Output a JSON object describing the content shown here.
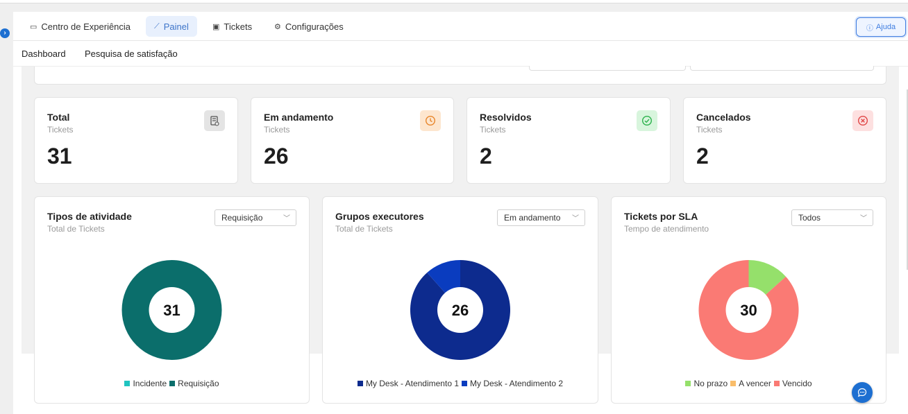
{
  "tabs": [
    {
      "label": "Centro de Experiência",
      "icon": "monitor-icon",
      "active": false
    },
    {
      "label": "Painel",
      "icon": "chart-line-icon",
      "active": true
    },
    {
      "label": "Tickets",
      "icon": "ticket-icon",
      "active": false
    },
    {
      "label": "Configurações",
      "icon": "gear-icon",
      "active": false
    }
  ],
  "help": {
    "label": "Ajuda",
    "icon": "question-circle-icon"
  },
  "subnav": {
    "dashboard": "Dashboard",
    "survey": "Pesquisa de satisfação"
  },
  "stats": [
    {
      "title": "Total",
      "sub": "Tickets",
      "value": "31",
      "icon": "document-icon",
      "color": "#e4e4e4",
      "icon_color": "#555555"
    },
    {
      "title": "Em andamento",
      "sub": "Tickets",
      "value": "26",
      "icon": "clock-icon",
      "color": "#fde6cf",
      "icon_color": "#e8852a"
    },
    {
      "title": "Resolvidos",
      "sub": "Tickets",
      "value": "2",
      "icon": "check-circle-icon",
      "color": "#d8f5dd",
      "icon_color": "#2bb24c"
    },
    {
      "title": "Cancelados",
      "sub": "Tickets",
      "value": "2",
      "icon": "x-circle-icon",
      "color": "#fde0e0",
      "icon_color": "#e04646"
    }
  ],
  "charts": [
    {
      "title": "Tipos de atividade",
      "sub": "Total de Tickets",
      "select": "Requisição",
      "center": "31"
    },
    {
      "title": "Grupos executores",
      "sub": "Total de Tickets",
      "select": "Em andamento",
      "center": "26"
    },
    {
      "title": "Tickets por SLA",
      "sub": "Tempo de atendimento",
      "select": "Todos",
      "center": "30"
    }
  ],
  "chart_data": [
    {
      "type": "pie",
      "title": "Tipos de atividade",
      "categories": [
        "Incidente",
        "Requisição"
      ],
      "values": [
        0,
        31
      ],
      "colors": [
        "#20c4c0",
        "#0b6e6b"
      ],
      "legend": "bottom"
    },
    {
      "type": "pie",
      "title": "Grupos executores",
      "categories": [
        "My Desk - Atendimento 1",
        "My Desk - Atendimento 2"
      ],
      "values": [
        23,
        3
      ],
      "colors": [
        "#0d2b8e",
        "#0a3cbf"
      ],
      "legend": "bottom"
    },
    {
      "type": "pie",
      "title": "Tickets por SLA",
      "categories": [
        "No prazo",
        "A vencer",
        "Vencido"
      ],
      "values": [
        4,
        0,
        26
      ],
      "colors": [
        "#95e06b",
        "#f9bd6a",
        "#fa7a74"
      ],
      "legend": "bottom"
    }
  ]
}
